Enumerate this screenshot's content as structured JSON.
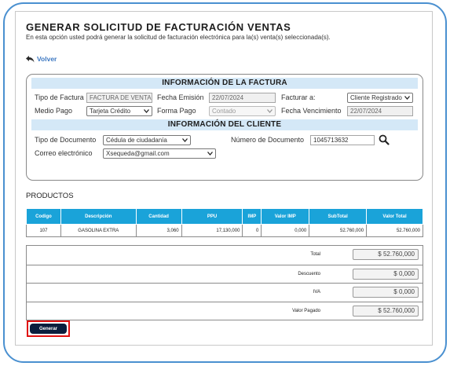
{
  "header": {
    "title": "GENERAR SOLICITUD DE FACTURACIÓN VENTAS",
    "subtitle": "En esta opción usted podrá generar la solicitud de facturación electrónica para la(s) venta(s) seleccionada(s).",
    "back_label": "Volver"
  },
  "invoice_info": {
    "section_title": "INFORMACIÓN DE LA FACTURA",
    "tipo_factura": {
      "label": "Tipo de Factura",
      "value": "FACTURA DE VENTA"
    },
    "fecha_emision": {
      "label": "Fecha Emisión",
      "value": "22/07/2024"
    },
    "facturar_a": {
      "label": "Facturar a:",
      "value": "Cliente Registrado"
    },
    "medio_pago": {
      "label": "Medio Pago",
      "value": "Tarjeta Crédito"
    },
    "forma_pago": {
      "label": "Forma Pago",
      "value": "Contado"
    },
    "fecha_vencimiento": {
      "label": "Fecha Vencimiento",
      "value": "22/07/2024"
    }
  },
  "client_info": {
    "section_title": "INFORMACIÓN DEL CLIENTE",
    "tipo_documento": {
      "label": "Tipo de Documento",
      "value": "Cédula de ciudadanía"
    },
    "numero_documento": {
      "label": "Número de Documento",
      "value": "1045713632"
    },
    "correo": {
      "label": "Correo electrónico",
      "value": "Xsequeda@gmail.com"
    }
  },
  "products": {
    "label": "PRODUCTOS",
    "columns": [
      "Codigo",
      "Descripción",
      "Cantidad",
      "PPU",
      "IMP",
      "Valor IMP",
      "SubTotal",
      "Valor Total"
    ],
    "rows": [
      [
        "107",
        "GASOLINA EXTRA",
        "3,060",
        "17,130,000",
        "0",
        "0,000",
        "52.760,000",
        "52.760,000"
      ]
    ]
  },
  "totals": [
    {
      "label": "Total",
      "value": "$ 52.760,000"
    },
    {
      "label": "Descuento",
      "value": "$ 0,000"
    },
    {
      "label": "IVA",
      "value": "$ 0,000"
    },
    {
      "label": "Valor Pagado",
      "value": "$ 52.760,000"
    }
  ],
  "actions": {
    "generate_label": "Generar"
  },
  "colors": {
    "frame_border": "#4a90d0",
    "section_bar": "#d4e8f7",
    "table_header": "#1aa3d9",
    "link": "#3d78c2",
    "generate_button": "#0a1e3d",
    "generate_highlight": "#e01010"
  },
  "icons": {
    "back": "back-arrow-icon",
    "search": "search-icon",
    "dropdown": "chevron-down-icon"
  }
}
